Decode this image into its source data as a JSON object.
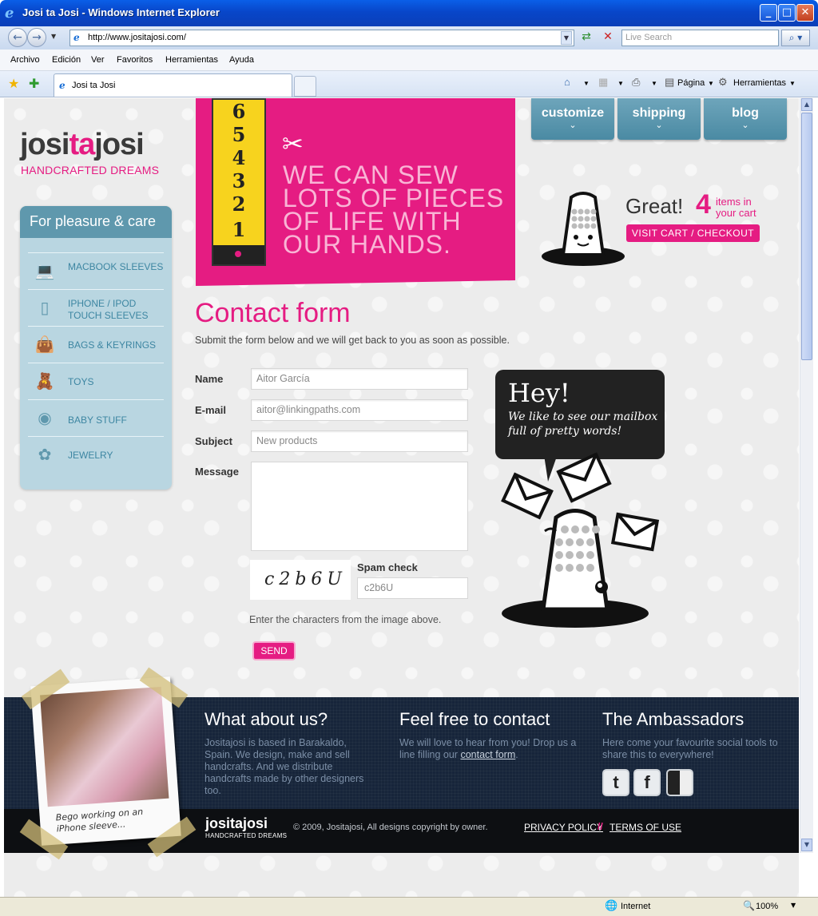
{
  "window": {
    "title": "Josi ta Josi - Windows Internet Explorer",
    "minimize_icon": "minimize-icon",
    "maximize_icon": "maximize-icon",
    "close_icon": "close-icon"
  },
  "navbar": {
    "url": "http://www.jositajosi.com/",
    "search_placeholder": "Live Search"
  },
  "menu": [
    "Archivo",
    "Edición",
    "Ver",
    "Favoritos",
    "Herramientas",
    "Ayuda"
  ],
  "tabs": {
    "active_label": "Josi ta Josi",
    "commands": {
      "page": "Página",
      "tools": "Herramientas"
    }
  },
  "site": {
    "logo": {
      "part1": "josi",
      "part2": "ta",
      "part3": "josi",
      "tagline": "HANDCRAFTED DREAMS"
    },
    "sidebar": {
      "title": "For pleasure & care",
      "items": [
        {
          "label": "MACBOOK SLEEVES",
          "icon": "laptop-icon"
        },
        {
          "label": "IPHONE / IPOD TOUCH SLEEVES",
          "icon": "phone-icon"
        },
        {
          "label": "BAGS & KEYRINGS",
          "icon": "bag-icon"
        },
        {
          "label": "TOYS",
          "icon": "teddy-bear-icon"
        },
        {
          "label": "BABY STUFF",
          "icon": "bib-icon"
        },
        {
          "label": "JEWELRY",
          "icon": "flower-icon"
        }
      ]
    },
    "banner": {
      "tape_numbers": [
        "6",
        "5",
        "4",
        "3",
        "2",
        "1"
      ],
      "text": "WE CAN SEW LOTS OF PIECES OF LIFE WITH OUR HANDS."
    },
    "topnav": [
      {
        "label": "customize"
      },
      {
        "label": "shipping"
      },
      {
        "label": "blog"
      }
    ],
    "cart": {
      "great": "Great!",
      "count": "4",
      "label": "items in your cart",
      "button": "VISIT CART / CHECKOUT"
    },
    "form": {
      "title": "Contact form",
      "intro": "Submit the form below and we will get back to you as soon as possible.",
      "fields": {
        "name_label": "Name",
        "name_value": "Aitor García",
        "email_label": "E-mail",
        "email_value": "aitor@linkingpaths.com",
        "subject_label": "Subject",
        "subject_value": "New products",
        "message_label": "Message",
        "message_value": ""
      },
      "captcha_text": "c2b6U",
      "spam_label": "Spam check",
      "spam_value": "c2b6U",
      "helper": "Enter the characters from the image above.",
      "send": "SEND"
    },
    "mascot": {
      "headline": "Hey!",
      "subline": "We like to see our mailbox full of pretty words!"
    },
    "footer": {
      "about_title": "What about us?",
      "about_text": "Jositajosi is based in Barakaldo, Spain. We design, make and sell handcrafts. And we distribute handcrafts made by other designers too.",
      "contact_title": "Feel free to contact",
      "contact_text": "We will love to hear from you! Drop us a line filling our",
      "contact_link": "contact form",
      "ambassadors_title": "The Ambassadors",
      "ambassadors_text": "Here come your favourite social tools to share this to everywhere!",
      "polaroid_caption": "Bego working on an iPhone sleeve...",
      "logo": "jositajosi",
      "tagline": "HANDCRAFTED DREAMS",
      "copyright": "© 2009, Jositajosi, All designs copyright by owner.",
      "privacy": "PRIVACY POLICY",
      "separator": "//",
      "terms": "TERMS OF USE"
    }
  },
  "status": {
    "zone": "Internet",
    "zoom": "100%"
  }
}
